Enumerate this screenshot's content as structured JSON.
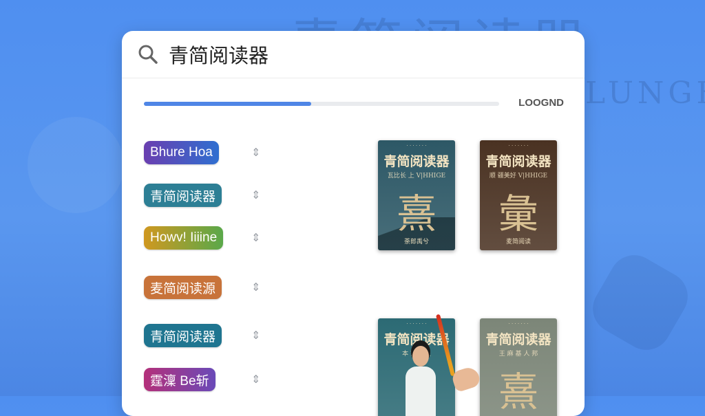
{
  "background": {
    "ghost_text": "青简阅读器",
    "ghost_sub": "LUNGH"
  },
  "search": {
    "value": "青简阅读器",
    "icon": "search-icon"
  },
  "progress": {
    "fraction": 0.47,
    "label": "LOOGND",
    "color": "#4f86e6"
  },
  "sources": [
    {
      "label": "Bhure Hoa",
      "color": "linear-gradient(90deg,#6a3fb0,#2f6fd0)"
    },
    {
      "label": "青简阅读器",
      "color": "#2d7f95"
    },
    {
      "label": "Howv! Iiiine",
      "color": "linear-gradient(90deg,#d09820,#5aa84a)"
    },
    {
      "label": "麦简阅读源",
      "color": "#c8733a"
    },
    {
      "label": "青简阅读器",
      "color": "#1f7590"
    },
    {
      "label": "霆澟 Be斩",
      "color": "linear-gradient(90deg,#b4307a,#6a4ab8)"
    }
  ],
  "drag_handle_icon": "drag-handle-icon",
  "books": [
    {
      "title": "青简阅读器",
      "top": "· · · · ·  · ·",
      "sub": "瓦比长 上 V|HHIGE",
      "glyph": "熹",
      "foot": "荼郎禹兮",
      "color": "#2d5866"
    },
    {
      "title": "青简阅读器",
      "top": "· · · · ·  · ·",
      "sub": "顺 疆美好 V|HHIGE",
      "glyph": "彙",
      "foot": "麦简阅读",
      "color": "#4a3222"
    },
    {
      "title": "青简阅读器",
      "top": "· · · · ·  · ·",
      "sub": "本 蓄圃 上",
      "glyph": "",
      "foot": "",
      "color": "#2c6a74"
    },
    {
      "title": "青简阅读器",
      "top": "· · · · ·  · ·",
      "sub": "王 麻 基 人 邦",
      "glyph": "熹",
      "foot": "",
      "color": "#7c8678"
    }
  ]
}
